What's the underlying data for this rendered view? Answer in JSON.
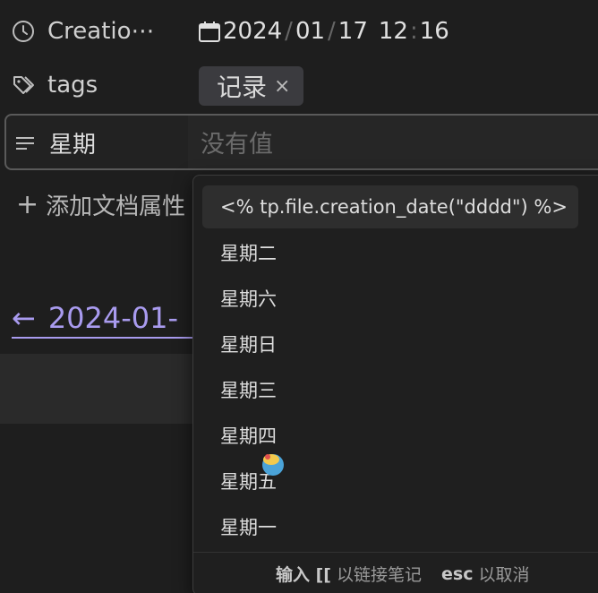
{
  "properties": {
    "created": {
      "icon": "clock-icon",
      "label": "Creatio⋯",
      "value": {
        "year": "2024",
        "month": "01",
        "day": "17",
        "hour": "12",
        "minute": "16"
      }
    },
    "tags": {
      "icon": "tag-icon",
      "label": "tags",
      "items": [
        {
          "label": "记录"
        }
      ]
    },
    "weekday": {
      "icon": "text-lines-icon",
      "label": "星期",
      "placeholder": "没有值"
    }
  },
  "add_property": {
    "label": "添加文档属性"
  },
  "backlink": {
    "label": "2024-01-"
  },
  "suggestions": {
    "items": [
      {
        "label": "<% tp.file.creation_date(\"dddd\") %>",
        "selected": true
      },
      {
        "label": "星期二"
      },
      {
        "label": "星期六"
      },
      {
        "label": "星期日"
      },
      {
        "label": "星期三"
      },
      {
        "label": "星期四"
      },
      {
        "label": "星期五"
      },
      {
        "label": "星期一"
      }
    ],
    "footer": {
      "input_key": "输入 [[",
      "input_text": "以链接笔记",
      "esc_key": "esc",
      "esc_text": "以取消"
    }
  },
  "colors": {
    "accent": "#a99bef",
    "background": "#1e1e1e"
  }
}
